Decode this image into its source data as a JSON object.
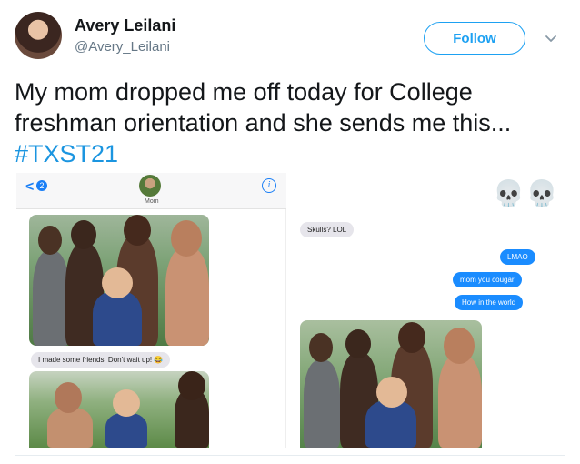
{
  "user": {
    "display_name": "Avery Leilani",
    "handle": "@Avery_Leilani"
  },
  "follow_button": {
    "label": "Follow"
  },
  "tweet": {
    "text": "My mom dropped me off today for College freshman orientation and she sends me this...",
    "hashtag": "#TXST21"
  },
  "left_screenshot": {
    "back_badge": "2",
    "contact_name": "Mom",
    "info_glyph": "i",
    "message": "I made some friends. Don't wait up! 😂"
  },
  "right_screenshot": {
    "skulls": "💀💀",
    "received": "Skulls? LOL",
    "sent": [
      "LMAO",
      "mom you cougar",
      "How in the world"
    ]
  },
  "colors": {
    "accent": "#1da1f2",
    "hashtag": "#1b95e0",
    "imessage_blue": "#1a8cff",
    "imessage_gray": "#e6e5eb"
  },
  "icons": [
    "chevron-down-icon",
    "back-chevron-icon",
    "info-icon",
    "avatar"
  ]
}
